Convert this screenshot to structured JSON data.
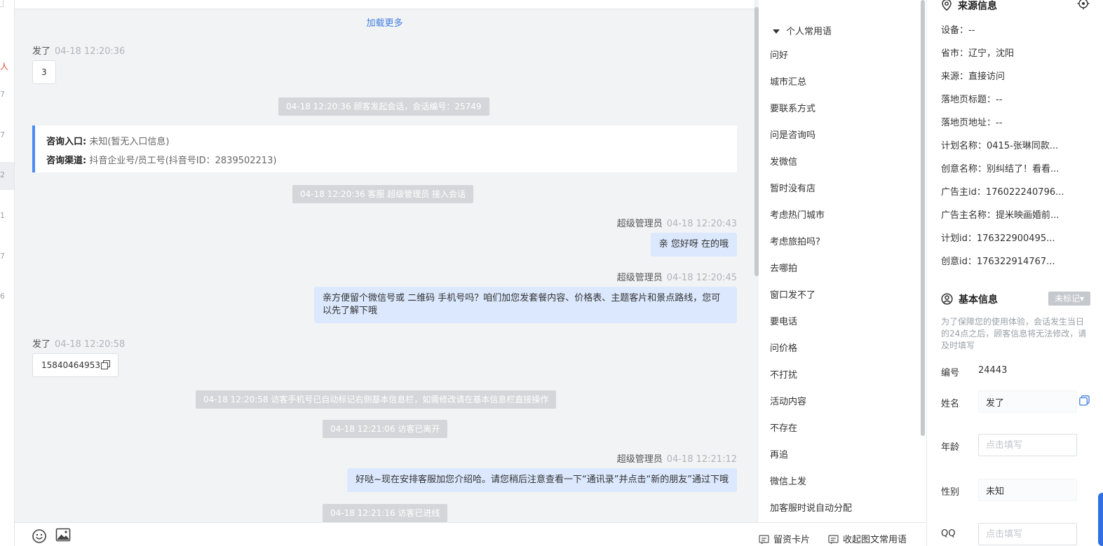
{
  "left_strip": {
    "numbers": [
      "7",
      "7",
      "2",
      "1",
      "7",
      "6"
    ],
    "partial_text": "人"
  },
  "chat": {
    "load_more": "加载更多",
    "messages": [
      {
        "name": "发了",
        "time": "04-18 12:20:36",
        "text": "3"
      },
      {
        "system": "04-18 12:20:36 顾客发起会话，会话编号：25749"
      },
      {
        "info_card": {
          "entry_label": "咨询入口:",
          "entry_value": "未知(暂无入口信息)",
          "channel_label": "咨询渠道:",
          "channel_value": "抖音企业号/员工号(抖音号ID：2839502213)"
        }
      },
      {
        "system": "04-18 12:20:36 客服 超级管理员 接入会话"
      },
      {
        "name": "超级管理员",
        "time": "04-18 12:20:43",
        "text": "亲 您好呀 在的哦"
      },
      {
        "name": "超级管理员",
        "time": "04-18 12:20:45",
        "text": "亲方便留个微信号或 二维码 手机号吗？咱们加您发套餐内容、价格表、主题客片和景点路线，您可以先了解下哦"
      },
      {
        "name": "发了",
        "time": "04-18 12:20:58",
        "text": "15840464953"
      },
      {
        "system": "04-18 12:20:58 访客手机号已自动标记右侧基本信息栏，如需修改请在基本信息栏直接操作"
      },
      {
        "system": "04-18 12:21:06 访客已离开"
      },
      {
        "name": "超级管理员",
        "time": "04-18 12:21:12",
        "text": "好哒~现在安排客服加您介绍哈。请您稍后注意查看一下“通讯录”并点击“新的朋友”通过下哦"
      },
      {
        "system": "04-18 12:21:16 访客已进线"
      }
    ]
  },
  "toolbar": {
    "emoji_icon": "smiley-icon",
    "image_icon": "image-icon",
    "lead_card_label": "留资卡片",
    "collapse_label": "收起图文常用语"
  },
  "phrases": {
    "header": "个人常用语",
    "items": [
      "问好",
      "城市汇总",
      "要联系方式",
      "问是咨询吗",
      "发微信",
      "暂时没有店",
      "考虑热门城市",
      "考虑旅拍吗?",
      "去哪拍",
      "窗口发不了",
      "要电话",
      "问价格",
      "不打扰",
      "活动内容",
      "不存在",
      "再追",
      "微信上发",
      "加客服时说自动分配"
    ]
  },
  "source": {
    "title": "来源信息",
    "rows": [
      "设备：--",
      "省市：辽宁，沈阳",
      "来源：直接访问",
      "落地页标题：--",
      "落地页地址：--",
      "计划名称：0415-张琳同款...",
      "创意名称：别纠结了！看看...",
      "广告主id：176022240796...",
      "广告主名称：提米映画婚前...",
      "计划id：176322900495...",
      "创意id：176322914767..."
    ]
  },
  "basic": {
    "title": "基本信息",
    "badge": "未标记▾",
    "notice": "为了保障您的使用体验，会话发生当日的24点之后，顾客信息将无法修改，请及时填写",
    "id_label": "编号",
    "id_value": "24443",
    "name_label": "姓名",
    "name_value": "发了",
    "age_label": "年龄",
    "age_placeholder": "点击填写",
    "gender_label": "性别",
    "gender_value": "未知",
    "qq_label": "QQ",
    "qq_placeholder": "点击填写"
  },
  "colors": {
    "accent": "#3f7fde",
    "agent_bubble": "#dbe8fd",
    "system_pill": "#d4d6d9",
    "card_border": "#4b8bf5"
  }
}
